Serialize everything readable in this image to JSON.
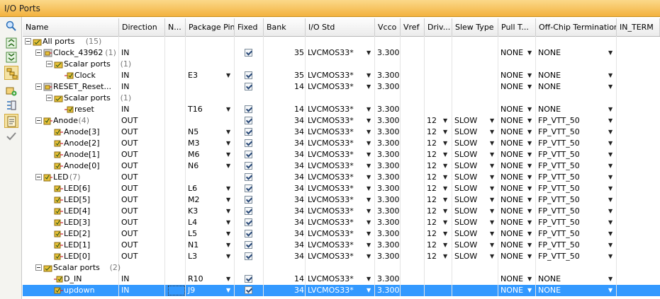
{
  "window": {
    "title": "I/O Ports"
  },
  "columns": [
    "Name",
    "Direction",
    "N...",
    "Package Pin",
    "Fixed",
    "Bank",
    "I/O Std",
    "Vcco",
    "Vref",
    "Driv...",
    "Slew Type",
    "Pull T...",
    "Off-Chip Termination",
    "IN_TERM"
  ],
  "toolbar": [
    "search-icon",
    "collapse-all-icon",
    "expand-all-icon",
    "group-by-interface-icon",
    "create-port-icon",
    "place-pins-icon",
    "auto-place-icon",
    "check-icon"
  ],
  "rows": [
    {
      "level": 0,
      "expander": true,
      "icon": "group",
      "name": "All ports",
      "count": "(15)",
      "dir": "",
      "pin": "",
      "fixed": false,
      "bank": "",
      "iostd": "",
      "vcco": "",
      "drive": "",
      "slew": "",
      "pull": "",
      "term": ""
    },
    {
      "level": 1,
      "expander": true,
      "icon": "bus",
      "name": "Clock_43962",
      "count": "(1)",
      "dir": "IN",
      "pin": "",
      "fixed": true,
      "bank": "35",
      "iostd": "LVCMOS33*",
      "vcco": "3.300",
      "drive": "",
      "slew": "",
      "pull": "NONE",
      "term": "NONE"
    },
    {
      "level": 2,
      "expander": true,
      "icon": "group",
      "name": "Scalar ports",
      "count": "(1)",
      "dir": "",
      "pin": "",
      "fixed": false,
      "bank": "",
      "iostd": "",
      "vcco": "",
      "drive": "",
      "slew": "",
      "pull": "",
      "term": ""
    },
    {
      "level": 3,
      "expander": false,
      "icon": "in",
      "name": "Clock",
      "count": "",
      "dir": "IN",
      "pin": "E3",
      "fixed": true,
      "bank": "35",
      "iostd": "LVCMOS33*",
      "vcco": "3.300",
      "drive": "",
      "slew": "",
      "pull": "NONE",
      "term": "NONE"
    },
    {
      "level": 1,
      "expander": true,
      "icon": "bus",
      "name": "RESET_Reset...",
      "count": "",
      "dir": "IN",
      "pin": "",
      "fixed": true,
      "bank": "14",
      "iostd": "LVCMOS33*",
      "vcco": "3.300",
      "drive": "",
      "slew": "",
      "pull": "NONE",
      "term": "NONE"
    },
    {
      "level": 2,
      "expander": true,
      "icon": "group",
      "name": "Scalar ports",
      "count": "(1)",
      "dir": "",
      "pin": "",
      "fixed": false,
      "bank": "",
      "iostd": "",
      "vcco": "",
      "drive": "",
      "slew": "",
      "pull": "",
      "term": ""
    },
    {
      "level": 3,
      "expander": false,
      "icon": "in",
      "name": "reset",
      "count": "",
      "dir": "IN",
      "pin": "T16",
      "fixed": true,
      "bank": "14",
      "iostd": "LVCMOS33*",
      "vcco": "3.300",
      "drive": "",
      "slew": "",
      "pull": "NONE",
      "term": "NONE"
    },
    {
      "level": 1,
      "expander": true,
      "icon": "outbus",
      "name": "Anode",
      "count": "(4)",
      "dir": "OUT",
      "pin": "",
      "fixed": true,
      "bank": "34",
      "iostd": "LVCMOS33*",
      "vcco": "3.300",
      "drive": "12",
      "slew": "SLOW",
      "pull": "NONE",
      "term": "FP_VTT_50"
    },
    {
      "level": 2,
      "expander": false,
      "icon": "out",
      "name": "Anode[3]",
      "count": "",
      "dir": "OUT",
      "pin": "N5",
      "fixed": true,
      "bank": "34",
      "iostd": "LVCMOS33*",
      "vcco": "3.300",
      "drive": "12",
      "slew": "SLOW",
      "pull": "NONE",
      "term": "FP_VTT_50"
    },
    {
      "level": 2,
      "expander": false,
      "icon": "out",
      "name": "Anode[2]",
      "count": "",
      "dir": "OUT",
      "pin": "M3",
      "fixed": true,
      "bank": "34",
      "iostd": "LVCMOS33*",
      "vcco": "3.300",
      "drive": "12",
      "slew": "SLOW",
      "pull": "NONE",
      "term": "FP_VTT_50"
    },
    {
      "level": 2,
      "expander": false,
      "icon": "out",
      "name": "Anode[1]",
      "count": "",
      "dir": "OUT",
      "pin": "M6",
      "fixed": true,
      "bank": "34",
      "iostd": "LVCMOS33*",
      "vcco": "3.300",
      "drive": "12",
      "slew": "SLOW",
      "pull": "NONE",
      "term": "FP_VTT_50"
    },
    {
      "level": 2,
      "expander": false,
      "icon": "out",
      "name": "Anode[0]",
      "count": "",
      "dir": "OUT",
      "pin": "N6",
      "fixed": true,
      "bank": "34",
      "iostd": "LVCMOS33*",
      "vcco": "3.300",
      "drive": "12",
      "slew": "SLOW",
      "pull": "NONE",
      "term": "FP_VTT_50"
    },
    {
      "level": 1,
      "expander": true,
      "icon": "outbus",
      "name": "LED",
      "count": "(7)",
      "dir": "OUT",
      "pin": "",
      "fixed": true,
      "bank": "34",
      "iostd": "LVCMOS33*",
      "vcco": "3.300",
      "drive": "12",
      "slew": "SLOW",
      "pull": "NONE",
      "term": "FP_VTT_50"
    },
    {
      "level": 2,
      "expander": false,
      "icon": "out",
      "name": "LED[6]",
      "count": "",
      "dir": "OUT",
      "pin": "L6",
      "fixed": true,
      "bank": "34",
      "iostd": "LVCMOS33*",
      "vcco": "3.300",
      "drive": "12",
      "slew": "SLOW",
      "pull": "NONE",
      "term": "FP_VTT_50"
    },
    {
      "level": 2,
      "expander": false,
      "icon": "out",
      "name": "LED[5]",
      "count": "",
      "dir": "OUT",
      "pin": "M2",
      "fixed": true,
      "bank": "34",
      "iostd": "LVCMOS33*",
      "vcco": "3.300",
      "drive": "12",
      "slew": "SLOW",
      "pull": "NONE",
      "term": "FP_VTT_50"
    },
    {
      "level": 2,
      "expander": false,
      "icon": "out",
      "name": "LED[4]",
      "count": "",
      "dir": "OUT",
      "pin": "K3",
      "fixed": true,
      "bank": "34",
      "iostd": "LVCMOS33*",
      "vcco": "3.300",
      "drive": "12",
      "slew": "SLOW",
      "pull": "NONE",
      "term": "FP_VTT_50"
    },
    {
      "level": 2,
      "expander": false,
      "icon": "out",
      "name": "LED[3]",
      "count": "",
      "dir": "OUT",
      "pin": "L4",
      "fixed": true,
      "bank": "34",
      "iostd": "LVCMOS33*",
      "vcco": "3.300",
      "drive": "12",
      "slew": "SLOW",
      "pull": "NONE",
      "term": "FP_VTT_50"
    },
    {
      "level": 2,
      "expander": false,
      "icon": "out",
      "name": "LED[2]",
      "count": "",
      "dir": "OUT",
      "pin": "L5",
      "fixed": true,
      "bank": "34",
      "iostd": "LVCMOS33*",
      "vcco": "3.300",
      "drive": "12",
      "slew": "SLOW",
      "pull": "NONE",
      "term": "FP_VTT_50"
    },
    {
      "level": 2,
      "expander": false,
      "icon": "out",
      "name": "LED[1]",
      "count": "",
      "dir": "OUT",
      "pin": "N1",
      "fixed": true,
      "bank": "34",
      "iostd": "LVCMOS33*",
      "vcco": "3.300",
      "drive": "12",
      "slew": "SLOW",
      "pull": "NONE",
      "term": "FP_VTT_50"
    },
    {
      "level": 2,
      "expander": false,
      "icon": "out",
      "name": "LED[0]",
      "count": "",
      "dir": "OUT",
      "pin": "L3",
      "fixed": true,
      "bank": "34",
      "iostd": "LVCMOS33*",
      "vcco": "3.300",
      "drive": "12",
      "slew": "SLOW",
      "pull": "NONE",
      "term": "FP_VTT_50"
    },
    {
      "level": 1,
      "expander": true,
      "icon": "group",
      "name": "Scalar ports",
      "count": "(2)",
      "dir": "",
      "pin": "",
      "fixed": false,
      "bank": "",
      "iostd": "",
      "vcco": "",
      "drive": "",
      "slew": "",
      "pull": "",
      "term": ""
    },
    {
      "level": 2,
      "expander": false,
      "icon": "in",
      "name": "D_IN",
      "count": "",
      "dir": "IN",
      "pin": "R10",
      "fixed": true,
      "bank": "14",
      "iostd": "LVCMOS33*",
      "vcco": "3.300",
      "drive": "",
      "slew": "",
      "pull": "NONE",
      "term": "NONE"
    },
    {
      "level": 2,
      "expander": false,
      "icon": "out",
      "name": "updown",
      "count": "",
      "dir": "IN",
      "pin": "J9",
      "fixed": true,
      "bank": "34",
      "iostd": "LVCMOS33*",
      "vcco": "3.300",
      "drive": "",
      "slew": "",
      "pull": "NONE",
      "term": "NONE",
      "selected": true
    }
  ],
  "colors": {
    "accent": "#f3b23f",
    "selection": "#3399ff",
    "icon_yellow": "#e8c23a"
  }
}
